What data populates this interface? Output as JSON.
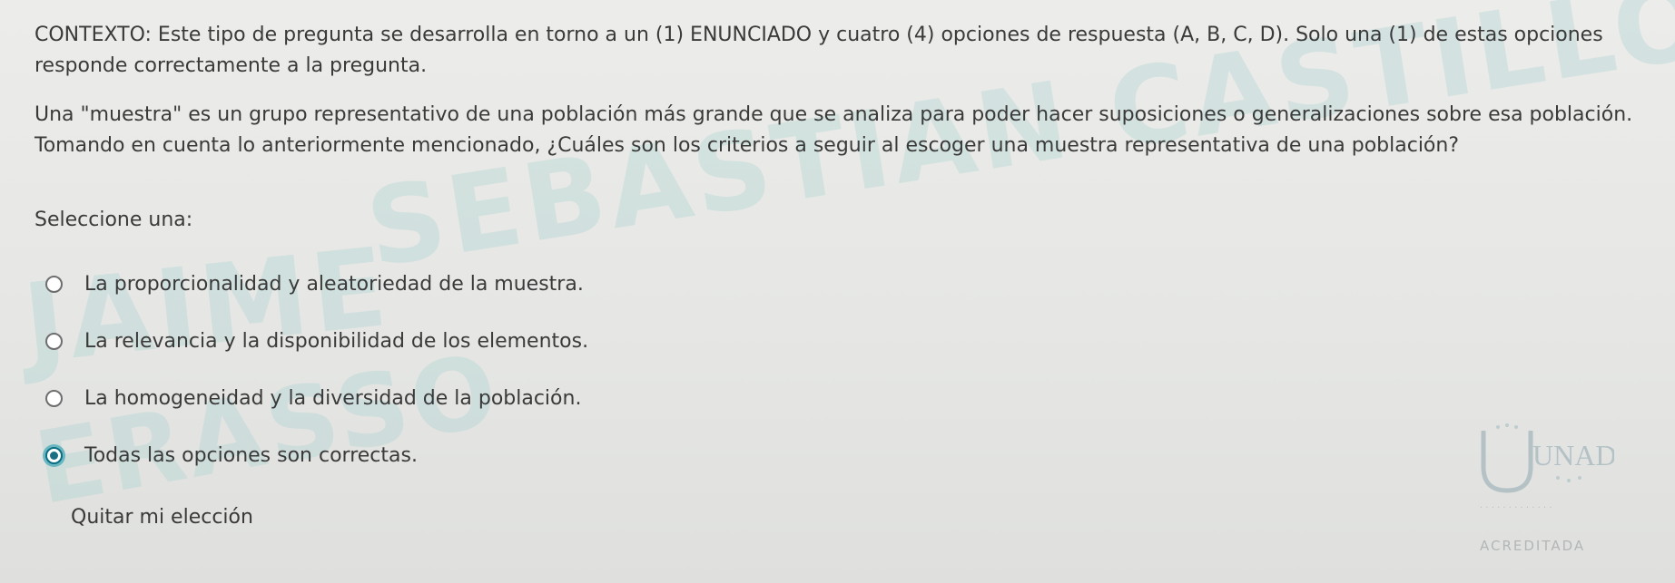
{
  "question": {
    "context": "CONTEXTO: Este tipo de pregunta se desarrolla en torno a un (1) ENUNCIADO y cuatro (4) opciones de respuesta (A, B, C, D). Solo una (1) de estas opciones responde correctamente a la pregunta.",
    "stem": "Una \"muestra\" es un grupo representativo de una población más grande que se analiza para poder hacer suposiciones o generalizaciones sobre esa población. Tomando en cuenta lo anteriormente mencionado, ¿Cuáles son los criterios a seguir al escoger una muestra representativa de una población?",
    "prompt": "Seleccione una:",
    "options": [
      {
        "label": "La proporcionalidad y aleatoriedad de la muestra.",
        "selected": false
      },
      {
        "label": "La relevancia y la disponibilidad de los elementos.",
        "selected": false
      },
      {
        "label": "La homogeneidad y la diversidad de la población.",
        "selected": false
      },
      {
        "label": "Todas las opciones son correctas.",
        "selected": true
      }
    ],
    "clear_choice": "Quitar mi elección"
  },
  "watermark": {
    "line1": "SEBASTIAN CASTILLO",
    "line2": "JAIME",
    "line3": "ERASSO"
  },
  "logo": {
    "name": "UNAD",
    "accreditation": "ACREDITADA"
  },
  "colors": {
    "background": "#e8e9e7",
    "text": "#3a3a3a",
    "selected_radio": "#1a6f84",
    "watermark": "#96cdc8"
  }
}
